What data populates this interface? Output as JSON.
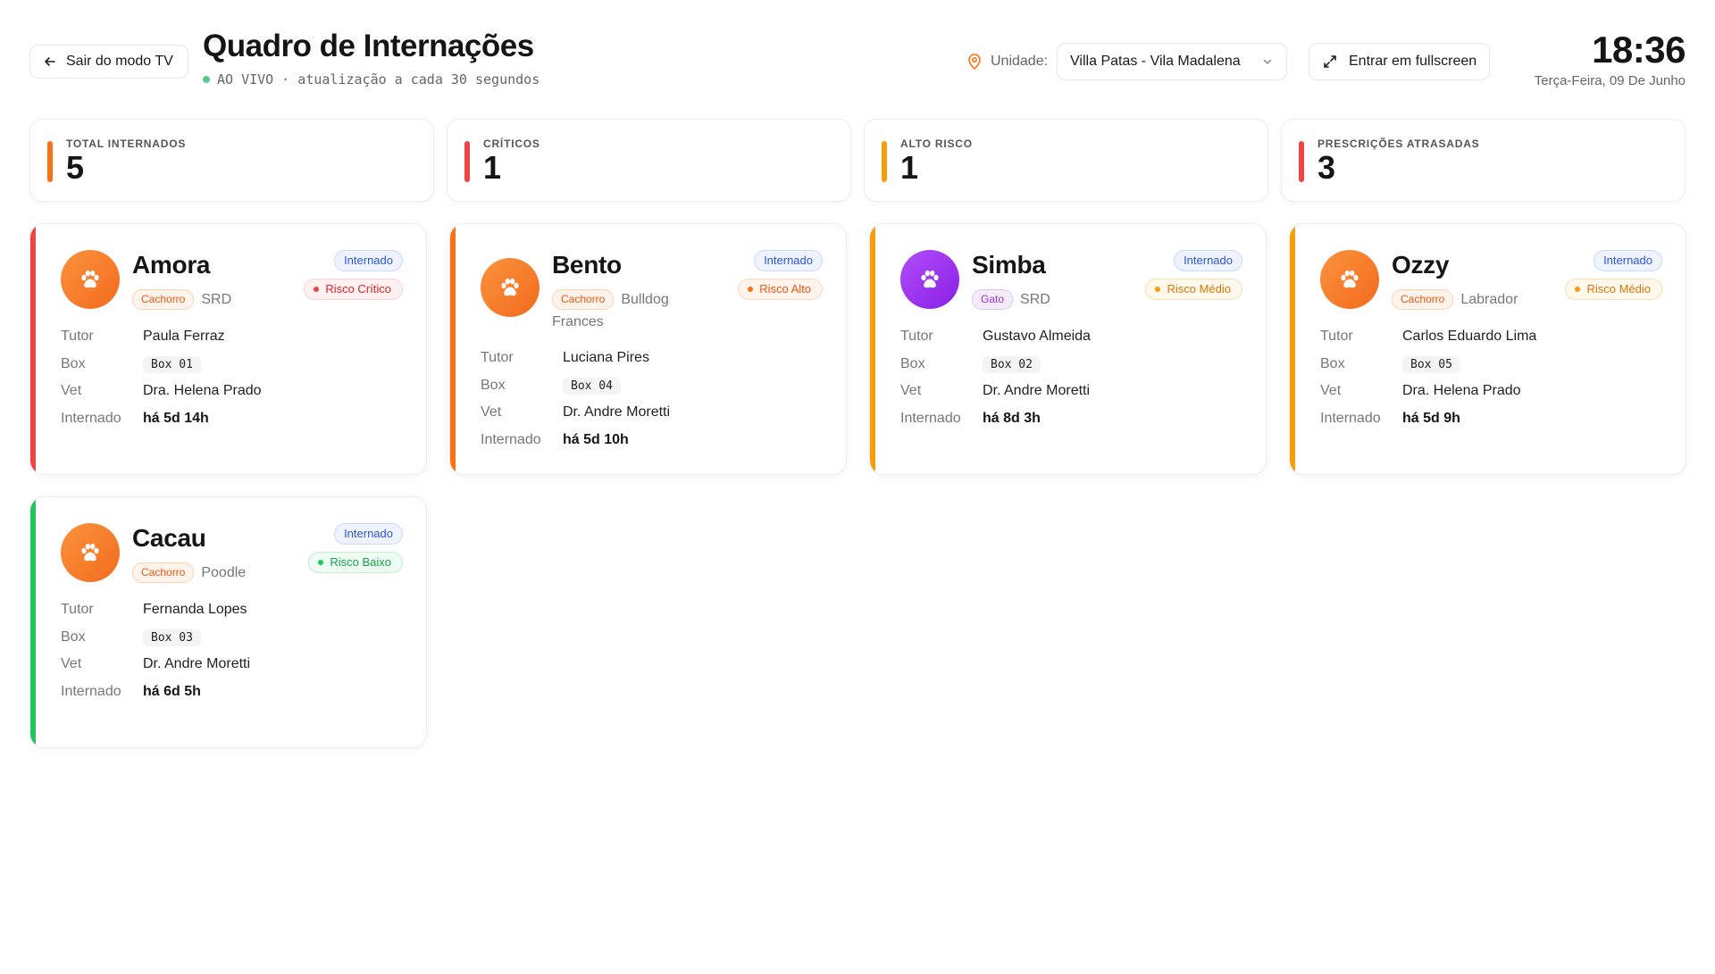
{
  "header": {
    "back_label": "Sair do modo TV",
    "title": "Quadro de Internações",
    "live_text": "AO VIVO · atualização a cada 30 segundos",
    "unit_label": "Unidade:",
    "unit_value": "Villa Patas - Vila Madalena",
    "fullscreen_label": "Entrar em fullscreen",
    "clock": "18:36",
    "date": "Terça-Feira, 09 De Junho"
  },
  "colors": {
    "orange": "#f97316",
    "red": "#ef4444",
    "amber": "#f59e0b",
    "green": "#22c55e",
    "purple": "#9333ea",
    "live_green": "#5bc98a",
    "status_blue": "#2c58d6"
  },
  "stats": [
    {
      "label": "Total internados",
      "value": "5",
      "color": "#f97316"
    },
    {
      "label": "Críticos",
      "value": "1",
      "color": "#ef4444"
    },
    {
      "label": "Alto risco",
      "value": "1",
      "color": "#f59e0b"
    },
    {
      "label": "Prescrições atrasadas",
      "value": "3",
      "color": "#ef4444"
    }
  ],
  "info_labels": {
    "tutor": "Tutor",
    "box": "Box",
    "vet": "Vet",
    "internado": "Internado"
  },
  "patients": [
    {
      "name": "Amora",
      "species": "Cachorro",
      "species_type": "dog",
      "breed": "SRD",
      "status": "Internado",
      "risk": "Risco Crítico",
      "risk_level": "critical",
      "tutor": "Paula Ferraz",
      "box": "Box 01",
      "vet": "Dra. Helena Prado",
      "time": "há 5d 14h",
      "icon": "paw-icon"
    },
    {
      "name": "Bento",
      "species": "Cachorro",
      "species_type": "dog",
      "breed": "Bulldog Frances",
      "status": "Internado",
      "risk": "Risco Alto",
      "risk_level": "high",
      "tutor": "Luciana Pires",
      "box": "Box 04",
      "vet": "Dr. Andre Moretti",
      "time": "há 5d 10h",
      "icon": "paw-icon"
    },
    {
      "name": "Simba",
      "species": "Gato",
      "species_type": "cat",
      "breed": "SRD",
      "status": "Internado",
      "risk": "Risco Médio",
      "risk_level": "medium",
      "tutor": "Gustavo Almeida",
      "box": "Box 02",
      "vet": "Dr. Andre Moretti",
      "time": "há 8d 3h",
      "icon": "paw-icon"
    },
    {
      "name": "Ozzy",
      "species": "Cachorro",
      "species_type": "dog",
      "breed": "Labrador",
      "status": "Internado",
      "risk": "Risco Médio",
      "risk_level": "medium",
      "tutor": "Carlos Eduardo Lima",
      "box": "Box 05",
      "vet": "Dra. Helena Prado",
      "time": "há 5d 9h",
      "icon": "paw-icon"
    },
    {
      "name": "Cacau",
      "species": "Cachorro",
      "species_type": "dog",
      "breed": "Poodle",
      "status": "Internado",
      "risk": "Risco Baixo",
      "risk_level": "low",
      "tutor": "Fernanda Lopes",
      "box": "Box 03",
      "vet": "Dr. Andre Moretti",
      "time": "há 6d 5h",
      "icon": "paw-icon"
    }
  ]
}
